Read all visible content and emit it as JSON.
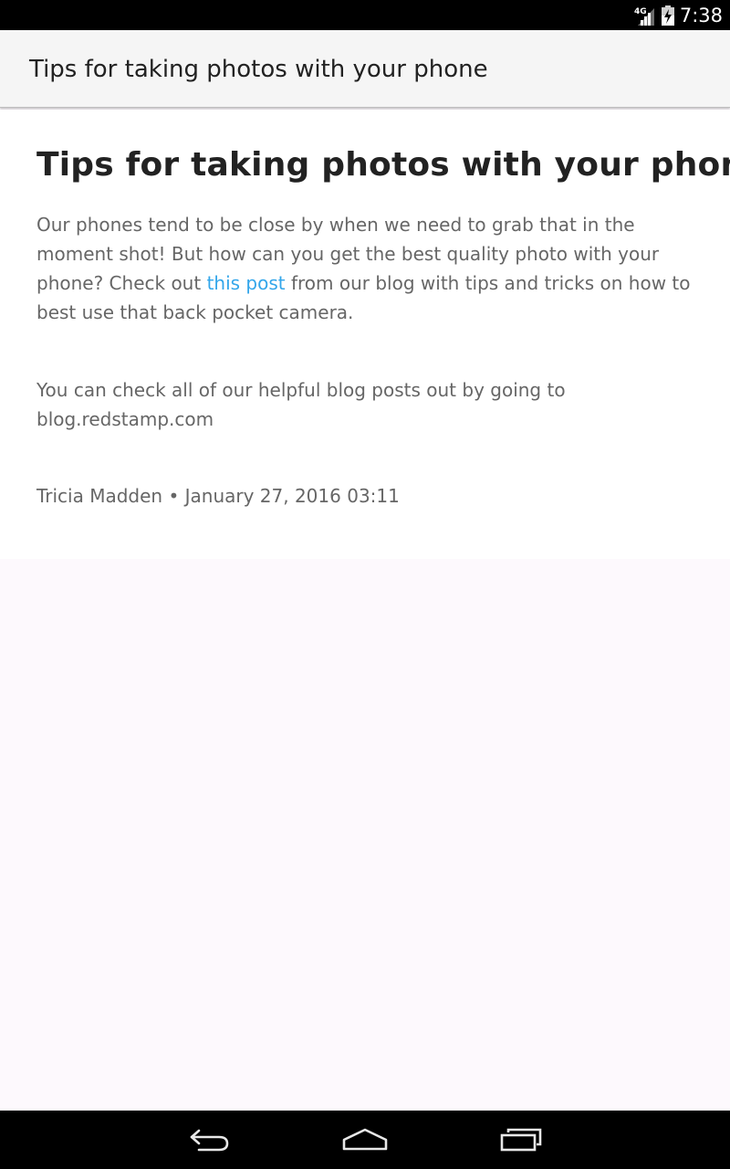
{
  "status_bar": {
    "network_type": "4G",
    "time": "7:38",
    "icons": [
      "signal-icon",
      "battery-charging-icon"
    ]
  },
  "action_bar": {
    "title": "Tips for taking photos with your phone"
  },
  "article": {
    "headline": "Tips for taking photos with your phone",
    "paragraph1": {
      "before_link": "Our phones tend to be close by when we need to grab that in the moment shot! But how can you get the best quality photo with your phone? Check out ",
      "link_text": "this post",
      "after_link": " from our blog with tips and tricks on how to best use that back pocket camera."
    },
    "paragraph2": "You can check all of our helpful blog posts out by going to blog.redstamp.com",
    "byline": "Tricia Madden • January 27, 2016 03:11"
  },
  "nav_bar": {
    "icons": [
      "back-icon",
      "home-icon",
      "recent-apps-icon"
    ]
  },
  "colors": {
    "link": "#33a6ea",
    "body_text": "#666666",
    "headline": "#222222",
    "action_bar_bg": "#f5f5f5",
    "page_bg": "#fdf9fd"
  }
}
